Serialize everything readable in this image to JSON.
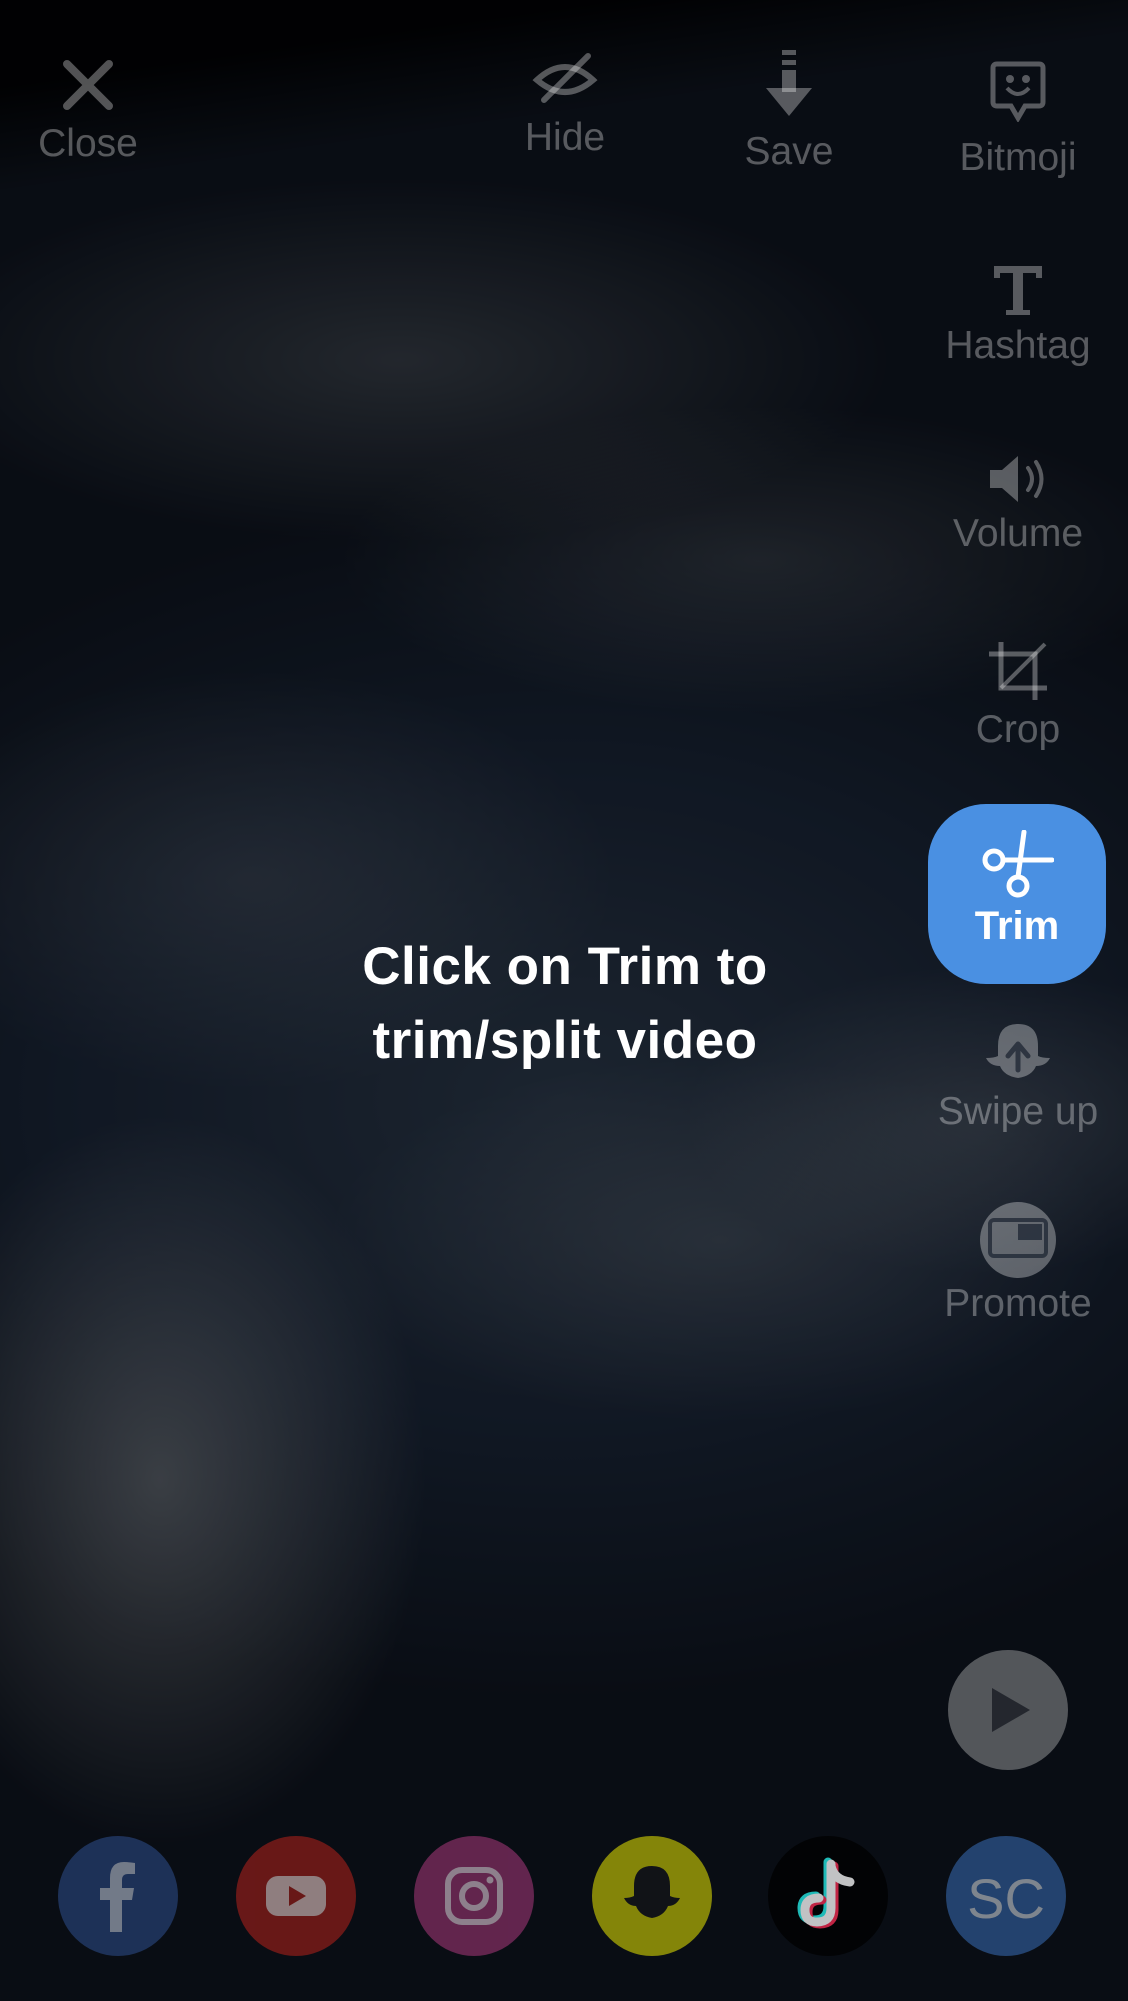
{
  "top_bar": {
    "close_label": "Close",
    "hide_label": "Hide",
    "save_label": "Save",
    "bitmoji_label": "Bitmoji"
  },
  "side_tools": {
    "hashtag_label": "Hashtag",
    "volume_label": "Volume",
    "crop_label": "Crop",
    "trim_label": "Trim",
    "swipe_up_label": "Swipe up",
    "promote_label": "Promote"
  },
  "hint": {
    "line1": "Click on Trim to",
    "line2": "trim/split video"
  },
  "share_targets": {
    "facebook": "facebook-icon",
    "youtube": "youtube-icon",
    "instagram": "instagram-icon",
    "snapchat": "snapchat-icon",
    "tiktok": "tiktok-icon",
    "soundcloud_label": "SC"
  },
  "colors": {
    "accent": "#4a90e2",
    "facebook": "#2f4f8f",
    "youtube": "#a8201a",
    "instagram": "#9e3574",
    "snapchat": "#fffc00",
    "tiktok": "#000000",
    "soundcloud": "#3a6fb8"
  }
}
